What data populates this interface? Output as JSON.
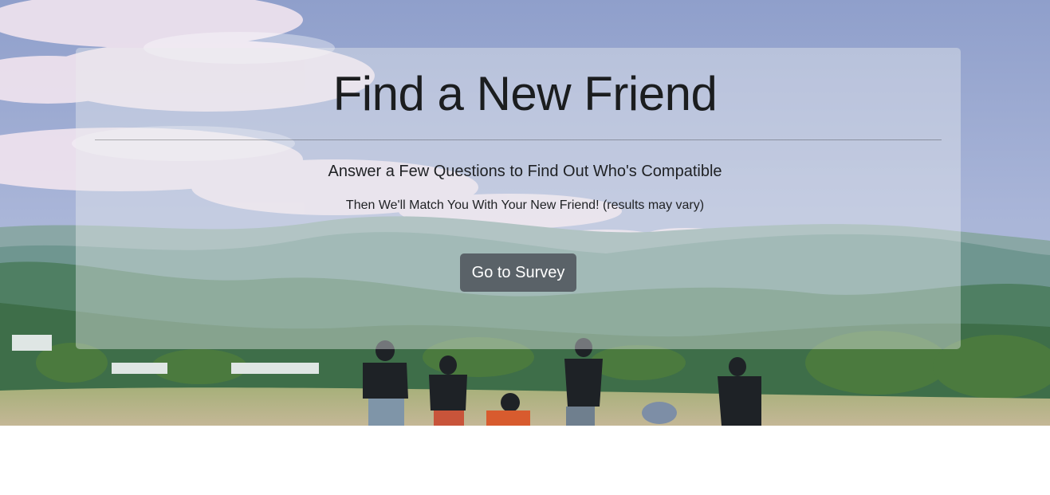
{
  "hero": {
    "background_image": "people-jumping-in-field-with-mountains",
    "colors": {
      "sky": "#9fb1d6",
      "cloud": "#f3e6f0",
      "mountains": "#5f8a86",
      "trees": "#3f6e4a",
      "field": "#b9b48a"
    }
  },
  "jumbotron": {
    "title": "Find a New Friend",
    "lead": "Answer a Few Questions to Find Out Who's Compatible",
    "subtext": "Then We'll Match You With Your New Friend! (results may vary)",
    "button_label": "Go to Survey",
    "button_color": "#5a6268"
  }
}
